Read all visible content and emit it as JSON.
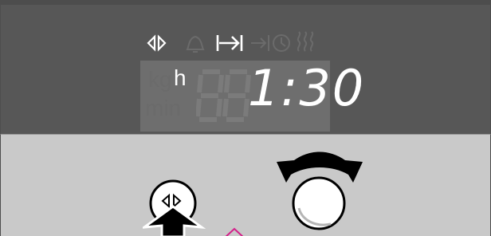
{
  "display": {
    "unit_kg": "kg",
    "unit_h": "h",
    "unit_min": "min",
    "time": "1:30"
  },
  "symbols": [
    {
      "name": "run-time-icon",
      "active": true
    },
    {
      "name": "timer-bell-icon",
      "active": false
    },
    {
      "name": "cooking-time-icon",
      "active": true
    },
    {
      "name": "end-time-icon",
      "active": false
    },
    {
      "name": "clock-icon",
      "active": false
    },
    {
      "name": "heating-icon",
      "active": false
    }
  ],
  "controls": {
    "button_symbol": "run-time-icon",
    "knob": "rotary-selector"
  },
  "colors": {
    "display_panel": "#575757",
    "control_panel": "#c9c9c9",
    "digit_on": "#ffffff",
    "digit_off": "#6b6b6b",
    "highlight": "#d4208a"
  }
}
